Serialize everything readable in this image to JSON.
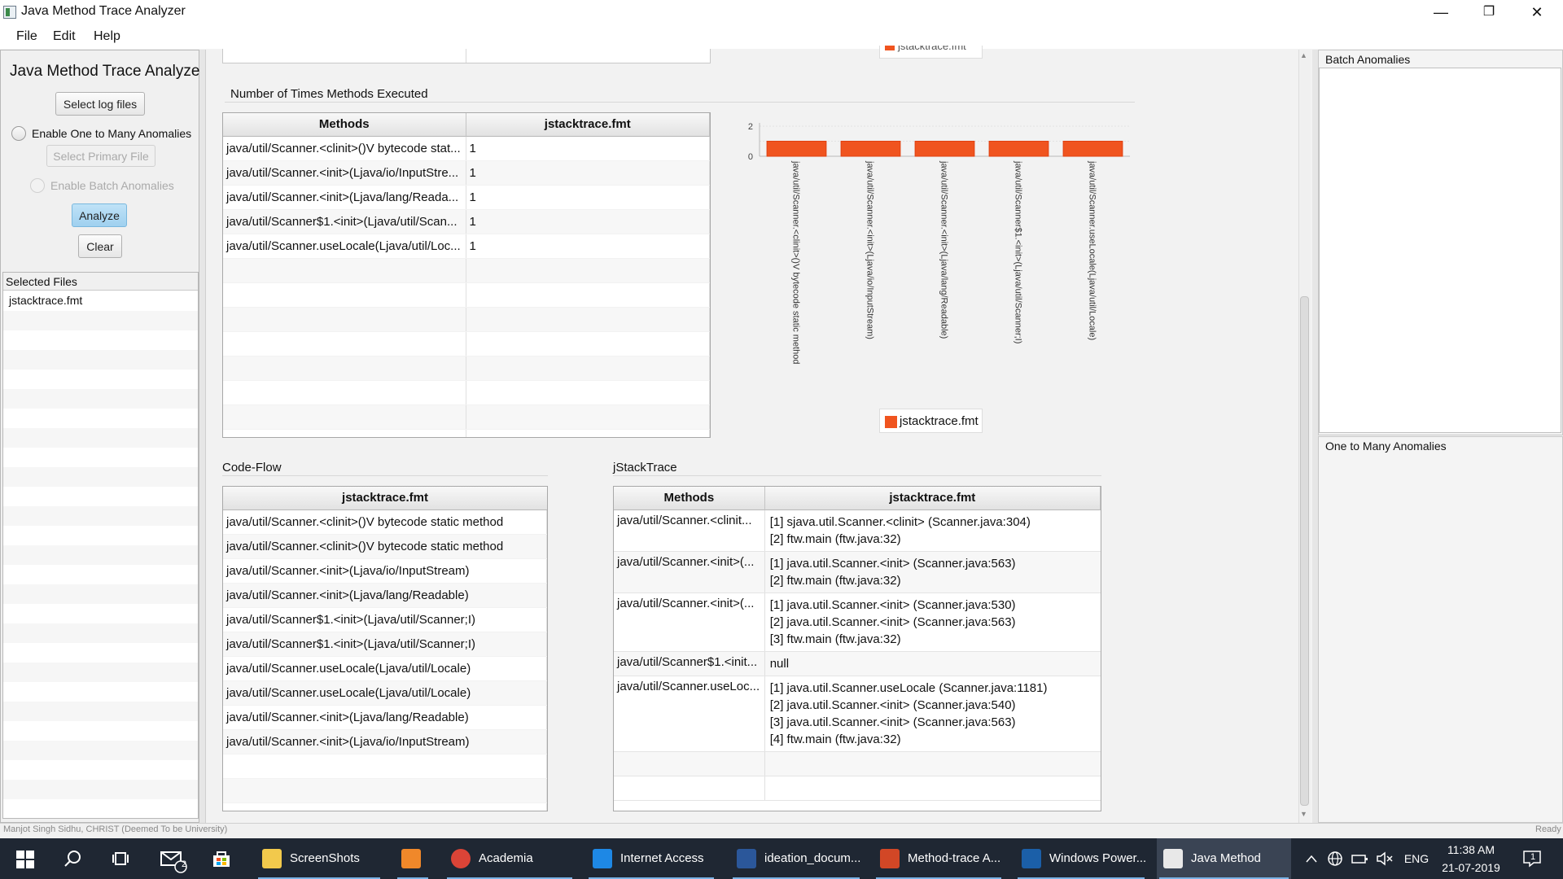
{
  "window": {
    "title": "Java Method Trace Analyzer",
    "minimize": "—",
    "restore": "❐",
    "close": "✕"
  },
  "menu": [
    "File",
    "Edit",
    "Help"
  ],
  "left": {
    "title": "Java Method Trace Analyzer",
    "select_log_files": "Select log files",
    "enable_one_to_many": "Enable One to Many Anomalies",
    "select_primary_file": "Select Primary File",
    "enable_batch": "Enable Batch Anomalies",
    "analyze": "Analyze",
    "clear": "Clear",
    "selected_files_header": "Selected Files",
    "selected_files": [
      "jstacktrace.fmt"
    ]
  },
  "count_table": {
    "title": "Number of Times Methods Executed",
    "headers": [
      "Methods",
      "jstacktrace.fmt"
    ],
    "rows": [
      [
        "java/util/Scanner.<clinit>()V bytecode stat...",
        "1"
      ],
      [
        "java/util/Scanner.<init>(Ljava/io/InputStre...",
        "1"
      ],
      [
        "java/util/Scanner.<init>(Ljava/lang/Reada...",
        "1"
      ],
      [
        "java/util/Scanner$1.<init>(Ljava/util/Scan...",
        "1"
      ],
      [
        "java/util/Scanner.useLocale(Ljava/util/Loc...",
        "1"
      ]
    ]
  },
  "chart_data": {
    "type": "bar",
    "categories": [
      "java/util/Scanner.<clinit>()V bytecode static method",
      "java/util/Scanner.<init>(Ljava/io/InputStream)",
      "java/util/Scanner.<init>(Ljava/lang/Readable)",
      "java/util/Scanner$1.<init>(Ljava/util/Scanner;I)",
      "java/util/Scanner.useLocale(Ljava/util/Locale)"
    ],
    "series": [
      {
        "name": "jstacktrace.fmt",
        "values": [
          1,
          1,
          1,
          1,
          1
        ],
        "color": "#f0541f"
      }
    ],
    "y_ticks": [
      "2",
      "0"
    ],
    "ylim": [
      0,
      2
    ],
    "legend": "bottom",
    "partial_legend_top": "jstacktrace.fmt"
  },
  "code_flow": {
    "title": "Code-Flow",
    "header": "jstacktrace.fmt",
    "rows": [
      "java/util/Scanner.<clinit>()V bytecode static method",
      "java/util/Scanner.<clinit>()V bytecode static method",
      "java/util/Scanner.<init>(Ljava/io/InputStream)",
      "java/util/Scanner.<init>(Ljava/lang/Readable)",
      "java/util/Scanner$1.<init>(Ljava/util/Scanner;I)",
      "java/util/Scanner$1.<init>(Ljava/util/Scanner;I)",
      "java/util/Scanner.useLocale(Ljava/util/Locale)",
      "java/util/Scanner.useLocale(Ljava/util/Locale)",
      "java/util/Scanner.<init>(Ljava/lang/Readable)",
      "java/util/Scanner.<init>(Ljava/io/InputStream)"
    ]
  },
  "jstack": {
    "title": "jStackTrace",
    "headers": [
      "Methods",
      "jstacktrace.fmt"
    ],
    "rows": [
      {
        "method": "java/util/Scanner.<clinit...",
        "trace": [
          "[1] sjava.util.Scanner.<clinit> (Scanner.java:304)",
          "[2] ftw.main (ftw.java:32)"
        ]
      },
      {
        "method": "java/util/Scanner.<init>(...",
        "trace": [
          "[1] java.util.Scanner.<init> (Scanner.java:563)",
          "[2] ftw.main (ftw.java:32)"
        ]
      },
      {
        "method": "java/util/Scanner.<init>(...",
        "trace": [
          "[1] java.util.Scanner.<init> (Scanner.java:530)",
          "[2] java.util.Scanner.<init> (Scanner.java:563)",
          "[3] ftw.main (ftw.java:32)"
        ]
      },
      {
        "method": "java/util/Scanner$1.<init...",
        "trace": [
          "null"
        ]
      },
      {
        "method": "java/util/Scanner.useLoc...",
        "trace": [
          "[1] java.util.Scanner.useLocale (Scanner.java:1181)",
          "[2] java.util.Scanner.<init> (Scanner.java:540)",
          "[3] java.util.Scanner.<init> (Scanner.java:563)",
          "[4] ftw.main (ftw.java:32)"
        ]
      }
    ]
  },
  "right": {
    "batch_title": "Batch Anomalies",
    "one_to_many_title": "One to Many Anomalies"
  },
  "status": {
    "left": "Manjot Singh Sidhu, CHRIST (Deemed To be University)",
    "right": "Ready"
  },
  "taskbar": {
    "apps": [
      {
        "label": "ScreenShots",
        "icon": "folder-icon",
        "color": "#f2c94c"
      },
      {
        "label": "",
        "icon": "sublime-icon",
        "color": "#f0882a"
      },
      {
        "label": "Academia Progr...",
        "icon": "chrome-icon",
        "color": "#db4437"
      },
      {
        "label": "Internet Access ...",
        "icon": "s-app-icon",
        "color": "#1e88e5"
      },
      {
        "label": "ideation_docum...",
        "icon": "word-icon",
        "color": "#2b579a"
      },
      {
        "label": "Method-trace A...",
        "icon": "powerpoint-icon",
        "color": "#d24726"
      },
      {
        "label": "Windows Power...",
        "icon": "powershell-icon",
        "color": "#1b5fa8"
      },
      {
        "label": "Java Method Tra...",
        "icon": "java-icon",
        "color": "#e8e8e8"
      }
    ],
    "mail_badge": "2",
    "lang": "ENG",
    "time": "11:38 AM",
    "date": "21-07-2019",
    "notif_count": "1"
  }
}
